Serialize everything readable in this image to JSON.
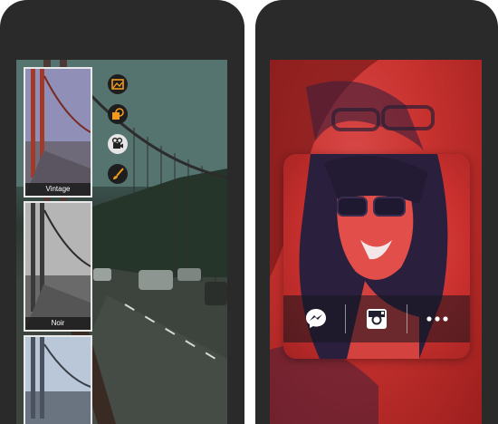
{
  "left_phone": {
    "filters": [
      {
        "label": "Vintage"
      },
      {
        "label": "Noir"
      },
      {
        "label": ""
      }
    ],
    "tools": [
      {
        "icon": "image-adjust-icon"
      },
      {
        "icon": "sticker-icon"
      },
      {
        "icon": "video-camera-icon"
      },
      {
        "icon": "brush-icon"
      }
    ],
    "accent": "#f39a1e"
  },
  "right_phone": {
    "share_actions": [
      {
        "icon": "messenger-icon"
      },
      {
        "icon": "instagram-icon"
      },
      {
        "icon": "more-icon"
      }
    ],
    "tint": "#c8322f"
  }
}
